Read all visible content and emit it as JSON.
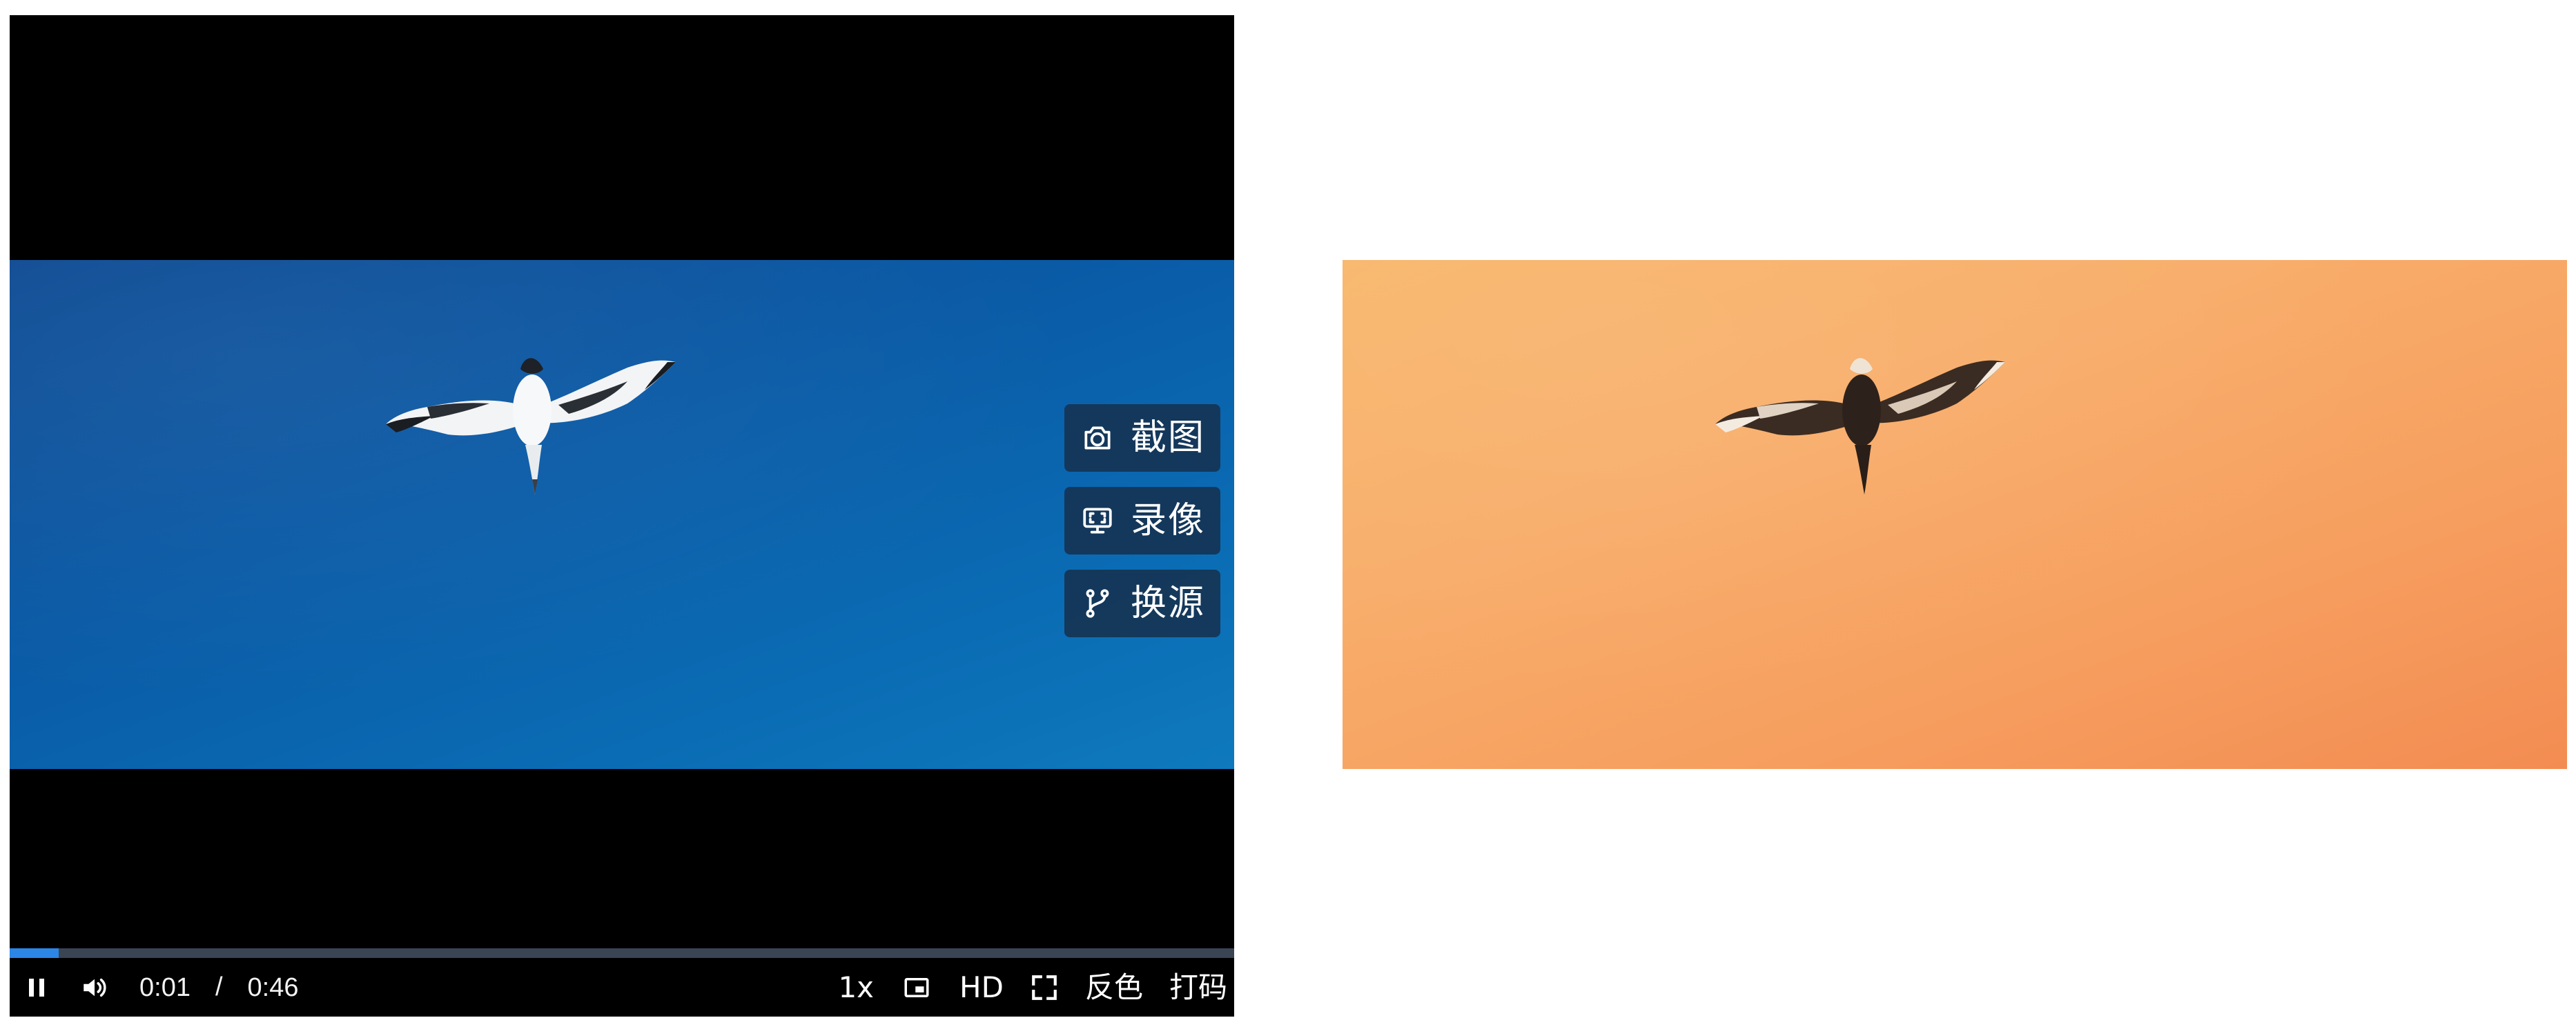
{
  "player": {
    "tools": [
      {
        "icon": "camera-icon",
        "label": "截图"
      },
      {
        "icon": "screen-record-icon",
        "label": "录像"
      },
      {
        "icon": "branch-icon",
        "label": "换源"
      }
    ],
    "progress": {
      "played_fraction": 0.04
    },
    "controls": {
      "current_time": "0:01",
      "separator": "/",
      "duration": "0:46",
      "speed": "1x",
      "quality": "HD",
      "invert_label": "反色",
      "mosaic_label": "打码"
    },
    "icons": {
      "play_state": "pause-icon",
      "volume": "volume-icon",
      "pip": "picture-in-picture-icon",
      "fullscreen": "fullscreen-icon"
    }
  },
  "colors": {
    "sky_blue": "#0a5aa6",
    "inverted_orange": "#f8ad6a",
    "progress_accent": "#2b86e6",
    "tool_button_bg": "#163454"
  }
}
